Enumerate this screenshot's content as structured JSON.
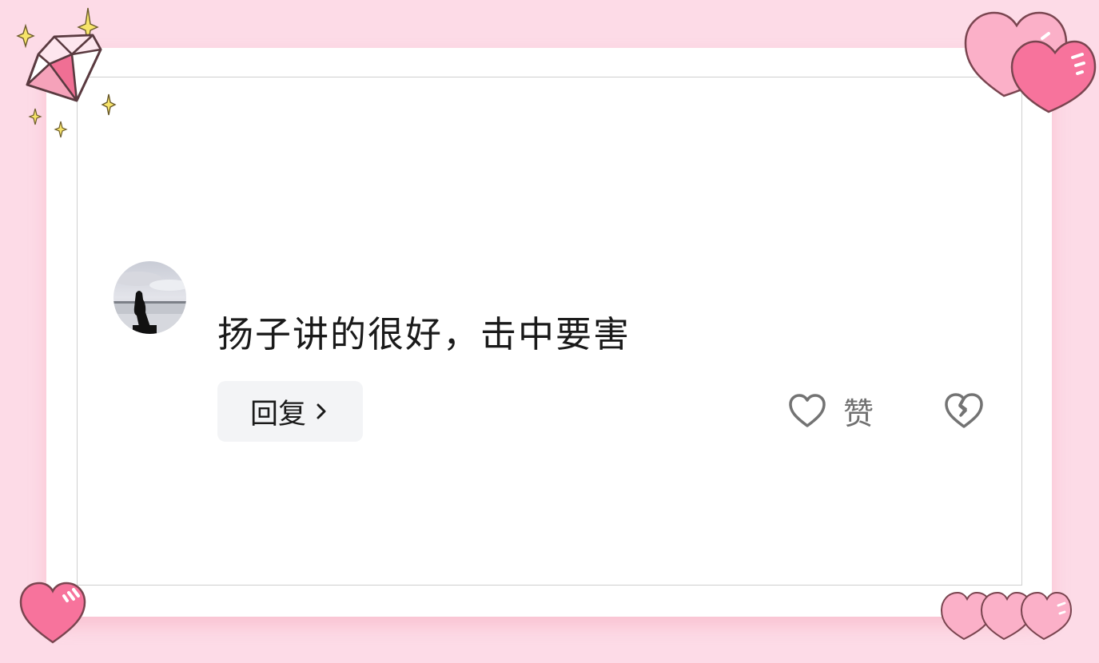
{
  "comment": {
    "text": "扬子讲的很好，击中要害",
    "avatar_icon": "avatar-silhouette-lake"
  },
  "actions": {
    "reply_label": "回复",
    "reply_icon": "chevron-right-icon",
    "like_label": "赞",
    "like_icon": "heart-outline-icon",
    "dislike_icon": "broken-heart-icon"
  },
  "decorations": {
    "top_left": "diamond-sparkles-icon",
    "top_right": "hearts-icon",
    "bottom_left": "heart-icon",
    "bottom_right": "three-hearts-icon"
  },
  "colors": {
    "background": "#fddbe7",
    "card": "#ffffff",
    "reply_bg": "#f3f4f6",
    "text": "#1a1a1a",
    "muted": "#707070",
    "heart_pink": "#f7739c",
    "heart_light": "#fbb0c8"
  }
}
